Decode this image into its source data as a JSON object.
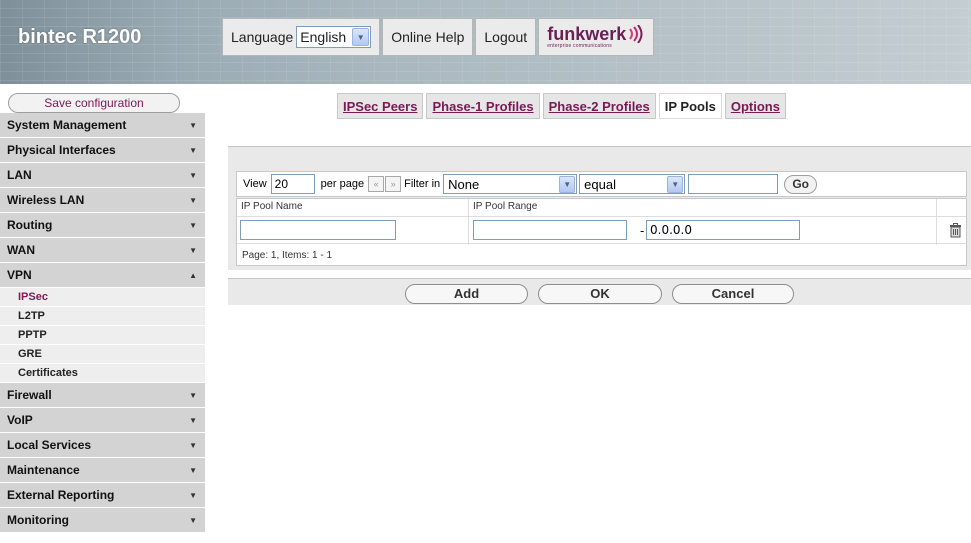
{
  "header": {
    "brand": "bintec R1200",
    "language_label": "Language",
    "language_value": "English",
    "online_help": "Online Help",
    "logout": "Logout",
    "logo_text": "funkwerk",
    "logo_sub": "enterprise communications"
  },
  "sidebar": {
    "save_label": "Save configuration",
    "items": [
      {
        "label": "System Management",
        "caret": "▼"
      },
      {
        "label": "Physical Interfaces",
        "caret": "▼"
      },
      {
        "label": "LAN",
        "caret": "▼"
      },
      {
        "label": "Wireless LAN",
        "caret": "▼"
      },
      {
        "label": "Routing",
        "caret": "▼"
      },
      {
        "label": "WAN",
        "caret": "▼"
      },
      {
        "label": "VPN",
        "caret": "▲"
      }
    ],
    "vpn_sub": [
      "IPSec",
      "L2TP",
      "PPTP",
      "GRE",
      "Certificates"
    ],
    "items_after": [
      {
        "label": "Firewall",
        "caret": "▼"
      },
      {
        "label": "VoIP",
        "caret": "▼"
      },
      {
        "label": "Local Services",
        "caret": "▼"
      },
      {
        "label": "Maintenance",
        "caret": "▼"
      },
      {
        "label": "External Reporting",
        "caret": "▼"
      },
      {
        "label": "Monitoring",
        "caret": "▼"
      }
    ]
  },
  "tabs": [
    "IPSec Peers",
    "Phase-1 Profiles",
    "Phase-2 Profiles",
    "IP Pools",
    "Options"
  ],
  "filter": {
    "view_label": "View",
    "view_value": "20",
    "per_page_label": "per page",
    "prev_label": "«",
    "next_label": "»",
    "filter_in_label": "Filter in",
    "filter_field": "None",
    "operator": "equal",
    "value": "",
    "go_label": "Go"
  },
  "table": {
    "col_name": "IP Pool Name",
    "col_range": "IP Pool Range",
    "row": {
      "name": "",
      "range_start": "",
      "separator": "-",
      "range_end": "0.0.0.0"
    },
    "footer": "Page: 1, Items: 1 - 1"
  },
  "actions": {
    "add": "Add",
    "ok": "OK",
    "cancel": "Cancel"
  },
  "colors": {
    "accent": "#7a1a54",
    "panel_bg": "#e9e9e9",
    "nav_bg": "#d3d3d3"
  }
}
